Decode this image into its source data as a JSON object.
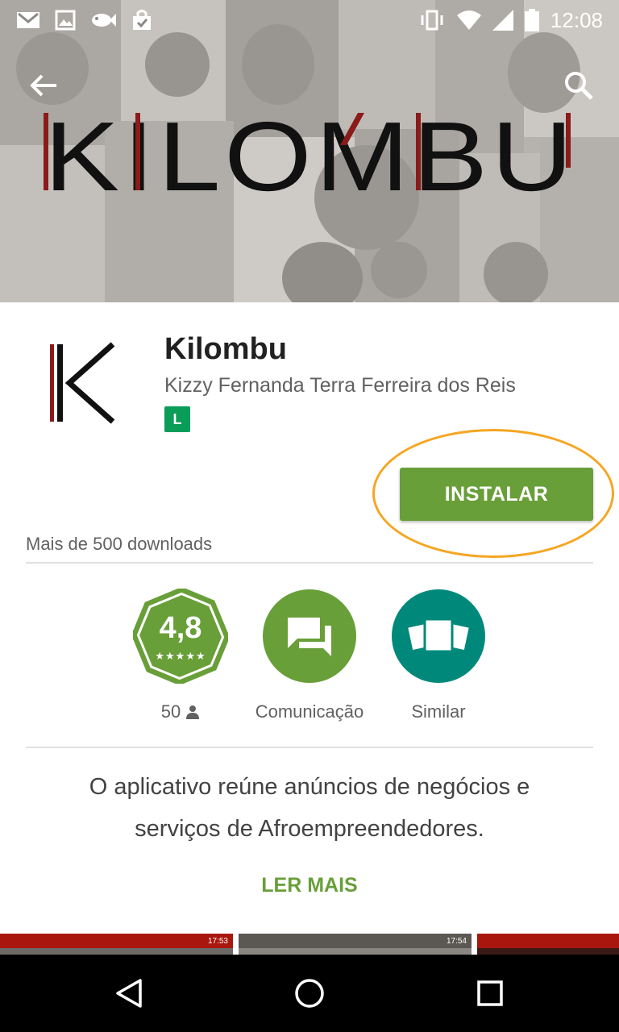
{
  "status_bar": {
    "time": "12:08",
    "left_icons": [
      "gmail-icon",
      "image-icon",
      "fish-icon",
      "shopping-bag-icon"
    ],
    "right_icons": [
      "vibrate-icon",
      "wifi-icon",
      "signal-icon",
      "battery-icon"
    ]
  },
  "hero": {
    "logo_text": "KILOMBU",
    "accent_color": "#8b1a1a"
  },
  "app": {
    "title": "Kilombu",
    "developer": "Kizzy Fernanda Terra Ferreira dos Reis",
    "content_rating": "L",
    "install_label": "INSTALAR",
    "downloads": "Mais de 500 downloads"
  },
  "badges": {
    "rating_value": "4,8",
    "rating_stars": "★★★★★",
    "reviews_count": "50",
    "category_label": "Comunicação",
    "similar_label": "Similar"
  },
  "description": {
    "text": "O aplicativo reúne anúncios de negócios e serviços de Afroempreendedores.",
    "read_more": "LER MAIS"
  },
  "screenshots": [
    {
      "time": "17:53"
    },
    {
      "time": "17:54"
    },
    {
      "time": ""
    }
  ],
  "colors": {
    "install_green": "#689f38",
    "badge_green": "#0a9d58",
    "category_green": "#689f38",
    "similar_teal": "#00897b",
    "highlight_orange": "#f5a623"
  }
}
